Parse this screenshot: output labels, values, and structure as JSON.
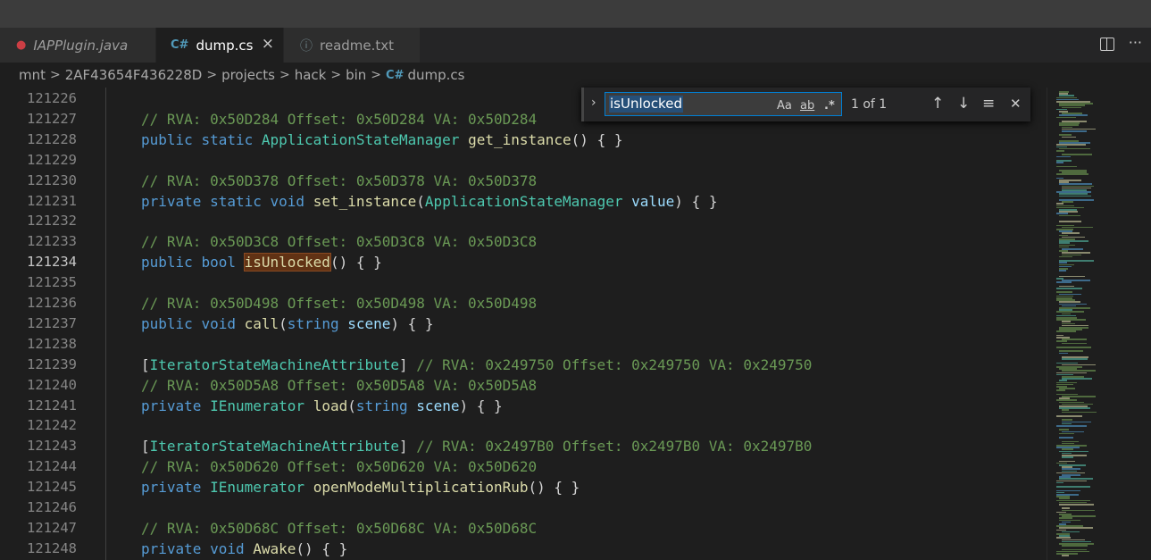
{
  "tabs": [
    {
      "label": "IAPPlugin.java",
      "icon": "java-icon",
      "active": false
    },
    {
      "label": "dump.cs",
      "icon": "csharp-icon",
      "active": true,
      "close": "×"
    },
    {
      "label": "readme.txt",
      "icon": "info-icon",
      "active": false
    }
  ],
  "tab_actions": {
    "more": "···"
  },
  "breadcrumb": [
    "mnt",
    "2AF43654F436228D",
    "projects",
    "hack",
    "bin",
    "dump.cs"
  ],
  "find": {
    "value": "isUnlocked",
    "match_case": "Aa",
    "whole_word": "ab",
    "regex": ".*",
    "count": "1 of 1",
    "prev": "↑",
    "next": "↓",
    "selection": "≡",
    "close": "✕"
  },
  "colors": {
    "accent": "#007fd4",
    "background": "#1e1e1e",
    "comment": "#6a9955",
    "keyword": "#569cd6",
    "type": "#4ec9b0",
    "function": "#dcdcaa"
  },
  "editor": {
    "active_line": "121234",
    "line_numbers": [
      "121226",
      "121227",
      "121228",
      "121229",
      "121230",
      "121231",
      "121232",
      "121233",
      "121234",
      "121235",
      "121236",
      "121237",
      "121238",
      "121239",
      "121240",
      "121241",
      "121242",
      "121243",
      "121244",
      "121245",
      "121246",
      "121247",
      "121248"
    ],
    "lines": [
      "",
      "// RVA: 0x50D284 Offset: 0x50D284 VA: 0x50D284",
      "public static ApplicationStateManager get_instance() { }",
      "",
      "// RVA: 0x50D378 Offset: 0x50D378 VA: 0x50D378",
      "private static void set_instance(ApplicationStateManager value) { }",
      "",
      "// RVA: 0x50D3C8 Offset: 0x50D3C8 VA: 0x50D3C8",
      "public bool isUnlocked() { }",
      "",
      "// RVA: 0x50D498 Offset: 0x50D498 VA: 0x50D498",
      "public void call(string scene) { }",
      "",
      "[IteratorStateMachineAttribute] // RVA: 0x249750 Offset: 0x249750 VA: 0x249750",
      "// RVA: 0x50D5A8 Offset: 0x50D5A8 VA: 0x50D5A8",
      "private IEnumerator load(string scene) { }",
      "",
      "[IteratorStateMachineAttribute] // RVA: 0x2497B0 Offset: 0x2497B0 VA: 0x2497B0",
      "// RVA: 0x50D620 Offset: 0x50D620 VA: 0x50D620",
      "private IEnumerator openModeMultiplicationRub() { }",
      "",
      "// RVA: 0x50D68C Offset: 0x50D68C VA: 0x50D68C",
      "private void Awake() { }"
    ]
  }
}
